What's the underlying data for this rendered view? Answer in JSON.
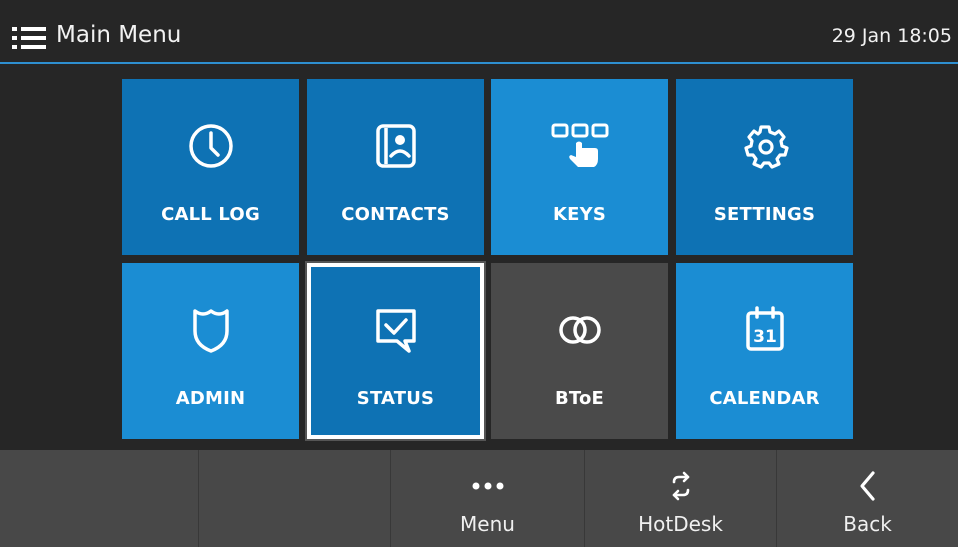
{
  "header": {
    "title": "Main Menu",
    "datetime": "29 Jan 18:05",
    "menu_icon": "list-menu-icon"
  },
  "colors": {
    "tile_blue_light": "#1b8dd3",
    "tile_blue_dark": "#0e72b4",
    "tile_gray": "#4a4a4a",
    "accent_line": "#2e8fd0",
    "background": "#262626",
    "softkey_bar": "#484848"
  },
  "tiles": [
    {
      "label": "CALL LOG",
      "icon": "clock-icon",
      "color": "#0e72b4",
      "selected": false
    },
    {
      "label": "CONTACTS",
      "icon": "contacts-book-icon",
      "color": "#0e72b4",
      "selected": false
    },
    {
      "label": "KEYS",
      "icon": "keypad-touch-icon",
      "color": "#1b8dd3",
      "selected": false
    },
    {
      "label": "SETTINGS",
      "icon": "gear-icon",
      "color": "#0e72b4",
      "selected": false
    },
    {
      "label": "ADMIN",
      "icon": "shield-icon",
      "color": "#1b8dd3",
      "selected": false
    },
    {
      "label": "STATUS",
      "icon": "status-check-icon",
      "color": "#0e72b4",
      "selected": true
    },
    {
      "label": "BToE",
      "icon": "linked-rings-icon",
      "color": "#4a4a4a",
      "selected": false
    },
    {
      "label": "CALENDAR",
      "icon": "calendar-icon",
      "color": "#1b8dd3",
      "selected": false
    }
  ],
  "calendar_day": "31",
  "softkeys": [
    {
      "label": "",
      "icon": ""
    },
    {
      "label": "",
      "icon": ""
    },
    {
      "label": "Menu",
      "icon": "more-dots-icon"
    },
    {
      "label": "HotDesk",
      "icon": "swap-arrows-icon"
    },
    {
      "label": "Back",
      "icon": "chevron-left-icon"
    }
  ]
}
